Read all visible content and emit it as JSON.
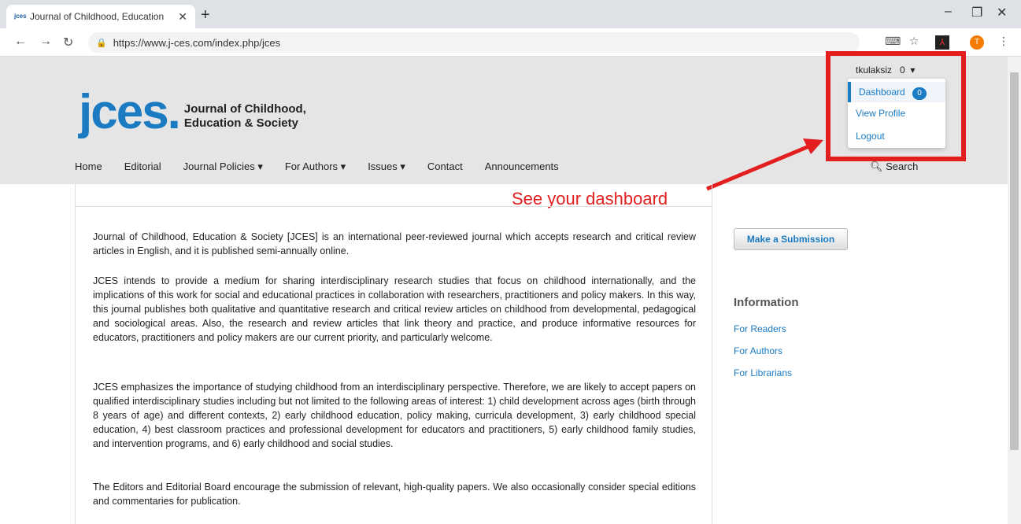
{
  "browser": {
    "tab_title": "Journal of Childhood, Education",
    "tab_favicon": "jces",
    "url": "https://www.j-ces.com/index.php/jces",
    "avatar_letter": "T"
  },
  "header": {
    "logo_big": "jces.",
    "logo_line1": "Journal of Childhood,",
    "logo_line2": "Education & Society",
    "nav": [
      "Home",
      "Editorial",
      "Journal Policies ▾",
      "For Authors ▾",
      "Issues ▾",
      "Contact",
      "Announcements"
    ],
    "search_label": "Search"
  },
  "user_menu": {
    "username": "tkulaksiz",
    "count": "0",
    "items": {
      "dashboard": "Dashboard",
      "dashboard_badge": "0",
      "profile": "View Profile",
      "logout": "Logout"
    }
  },
  "annotation": {
    "text": "See your dashboard",
    "color": "#e31e1e"
  },
  "content": {
    "paragraphs": [
      "Journal of Childhood, Education & Society [JCES] is an international peer-reviewed journal which accepts research and critical review articles in English, and it is published semi-annually online.",
      "JCES intends to provide a medium for sharing interdisciplinary research studies that focus on childhood internationally, and the implications of this work for social and educational practices in collaboration with researchers, practitioners and policy makers. In this way, this journal publishes both qualitative and quantitative research and critical review articles on childhood from developmental, pedagogical and sociological areas. Also, the research and review articles that link theory and practice, and produce informative resources for educators, practitioners and policy makers are our current priority, and particularly welcome.",
      "JCES emphasizes the importance of studying childhood from an interdisciplinary perspective. Therefore, we are likely to accept papers on qualified interdisciplinary studies including but not limited to the following areas of interest: 1) child development across ages (birth through 8 years of age) and different contexts, 2) early childhood education, policy making, curricula development, 3) early childhood special education, 4) best classroom practices and professional development for educators and practitioners, 5) early childhood family studies, and intervention programs, and 6) early childhood and social studies.",
      "The Editors and Editorial Board encourage the submission of relevant, high-quality papers. We also occasionally consider special editions and commentaries for publication."
    ]
  },
  "sidebar": {
    "submit_label": "Make a Submission",
    "info_title": "Information",
    "links": [
      "For Readers",
      "For Authors",
      "For Librarians"
    ]
  },
  "colors": {
    "accent": "#1a7ac2",
    "highlight": "#e31e1e",
    "header_bg": "#e5e5e5"
  }
}
